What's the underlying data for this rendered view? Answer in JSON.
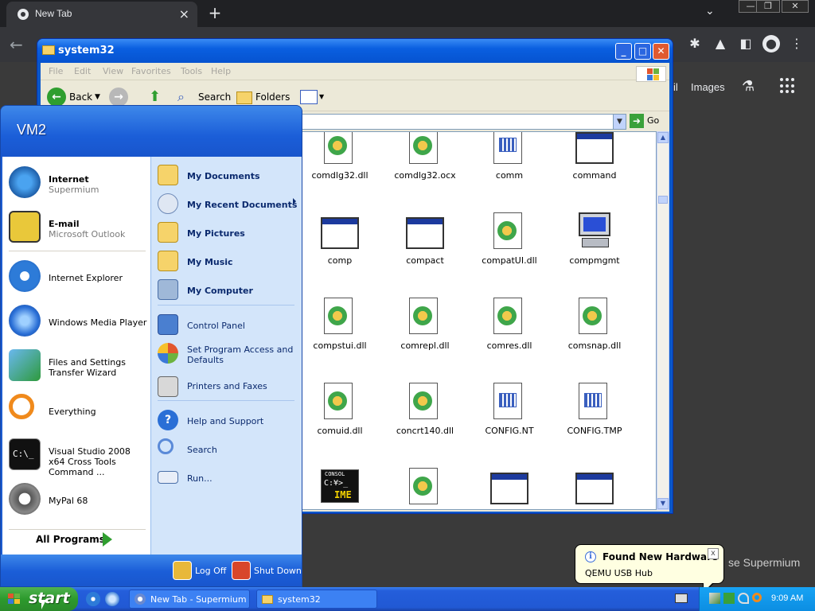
{
  "browser": {
    "tab_title": "New Tab",
    "tab_close": "×",
    "new_tab": "+",
    "tab_menu": "⌄",
    "win_min": "—",
    "win_restore": "❐",
    "win_close": "✕",
    "back": "←",
    "links": {
      "gmail_partial": "il",
      "images": "Images"
    },
    "background_text": "se Supermium"
  },
  "explorer": {
    "title": "system32",
    "buttons": {
      "minimize": "_",
      "maximize": "□",
      "close": "✕"
    },
    "menu": [
      "File",
      "Edit",
      "View",
      "Favorites",
      "Tools",
      "Help"
    ],
    "toolbar": {
      "back": "Back",
      "search": "Search",
      "folders": "Folders"
    },
    "address": {
      "go": "Go"
    },
    "files": [
      {
        "name": "comdlg32.dll",
        "icon": "dll-icon"
      },
      {
        "name": "comdlg32.ocx",
        "icon": "dll-icon"
      },
      {
        "name": "comm",
        "icon": "settings-icon"
      },
      {
        "name": "command",
        "icon": "window-app-icon"
      },
      {
        "name": "comp",
        "icon": "window-app-icon"
      },
      {
        "name": "compact",
        "icon": "window-app-icon"
      },
      {
        "name": "compatUI.dll",
        "icon": "dll-icon"
      },
      {
        "name": "compmgmt",
        "icon": "computer-icon"
      },
      {
        "name": "compstui.dll",
        "icon": "dll-icon"
      },
      {
        "name": "comrepl.dll",
        "icon": "dll-icon"
      },
      {
        "name": "comres.dll",
        "icon": "dll-icon"
      },
      {
        "name": "comsnap.dll",
        "icon": "dll-icon"
      },
      {
        "name": "comuid.dll",
        "icon": "dll-icon"
      },
      {
        "name": "concrt140.dll",
        "icon": "dll-icon"
      },
      {
        "name": "CONFIG.NT",
        "icon": "settings-icon"
      },
      {
        "name": "CONFIG.TMP",
        "icon": "settings-icon"
      },
      {
        "name": "",
        "icon": "ime-icon"
      },
      {
        "name": "",
        "icon": "dll-icon"
      },
      {
        "name": "",
        "icon": "window-app-icon"
      },
      {
        "name": "",
        "icon": "window-app-icon"
      }
    ],
    "ime_text": {
      "label": "CONSOL",
      "prompt": "C:¥>_",
      "ime": "IME"
    }
  },
  "start_menu": {
    "user": "VM2",
    "pinned": [
      {
        "title": "Internet",
        "sub": "Supermium"
      },
      {
        "title": "E-mail",
        "sub": "Microsoft Outlook"
      }
    ],
    "recent": [
      "Internet Explorer",
      "Windows Media Player",
      "Files and Settings Transfer Wizard",
      "Everything",
      "Visual Studio 2008 x64 Cross Tools Command ...",
      "MyPal 68"
    ],
    "all_programs": "All Programs",
    "right": {
      "my_documents": "My Documents",
      "my_recent_documents": "My Recent Documents",
      "my_pictures": "My Pictures",
      "my_music": "My Music",
      "my_computer": "My Computer",
      "control_panel": "Control Panel",
      "set_program_access": "Set Program Access and Defaults",
      "printers_faxes": "Printers and Faxes",
      "help_support": "Help and Support",
      "search": "Search",
      "run": "Run..."
    },
    "log_off": "Log Off",
    "shut_down": "Shut Down"
  },
  "taskbar": {
    "start": "start",
    "tasks": [
      "New Tab - Supermium",
      "system32"
    ],
    "clock": "9:09 AM"
  },
  "balloon": {
    "title": "Found New Hardware",
    "message": "QEMU USB Hub",
    "info": "i",
    "close": "x"
  }
}
